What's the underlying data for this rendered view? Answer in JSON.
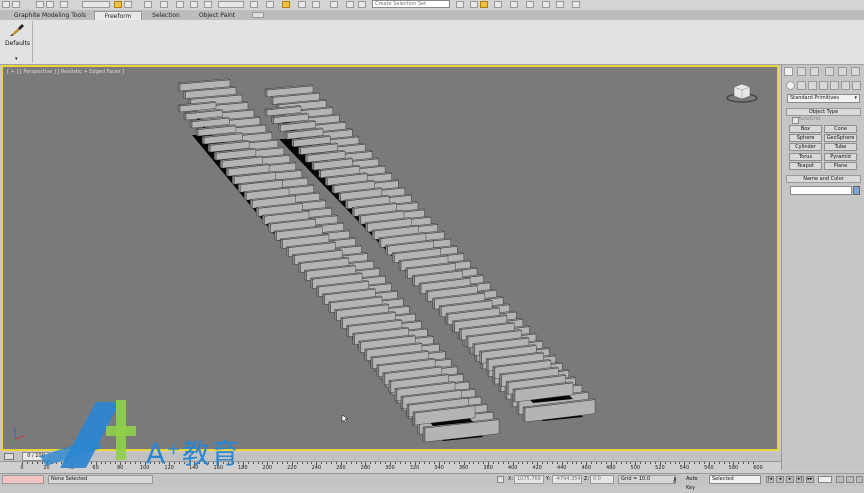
{
  "toolbar": {
    "search_placeholder": "Create Selection Set",
    "icons": [
      "undo-icon",
      "redo-icon",
      "link-icon",
      "unlink-icon",
      "bind-icon",
      "select-filter-icon",
      "select-object-icon",
      "select-by-name-icon",
      "rect-select-icon",
      "window-crossing-icon",
      "move-icon",
      "rotate-icon",
      "scale-icon",
      "ref-coord-icon",
      "pivot-icon",
      "snap-icon",
      "angle-snap-icon",
      "percent-snap-icon",
      "spinner-snap-icon",
      "edit-named-sel-icon",
      "mirror-icon",
      "align-icon",
      "layer-icon",
      "curve-editor-icon",
      "schematic-icon",
      "material-editor-icon",
      "render-setup-icon",
      "render-frame-icon",
      "render-icon"
    ]
  },
  "ribbon": {
    "tabs": [
      "Graphite Modeling Tools",
      "Freeform",
      "Selection",
      "Object Paint"
    ],
    "active_tab": "Freeform",
    "defaults_label": "Defaults"
  },
  "viewport": {
    "label": "[ + ] [ Perspective ] [ Realistic + Edged Faces ]"
  },
  "command_panel": {
    "dropdown": "Standard Primitives",
    "object_type_title": "Object Type",
    "autogrid_label": "AutoGrid",
    "buttons": [
      "Box",
      "Cone",
      "Sphere",
      "GeoSphere",
      "Cylinder",
      "Tube",
      "Torus",
      "Pyramid",
      "Teapot",
      "Plane"
    ],
    "name_color_title": "Name and Color",
    "swatch_color": "#7fa4d8"
  },
  "timeline": {
    "slider": "0 / 100",
    "ticks": [
      "0",
      "20",
      "40",
      "60",
      "80",
      "100",
      "120",
      "140",
      "160",
      "180",
      "200",
      "220",
      "240",
      "260",
      "280",
      "300",
      "320",
      "340",
      "360",
      "380",
      "400",
      "420",
      "440",
      "460",
      "480",
      "500",
      "520",
      "540",
      "560",
      "580",
      "600"
    ]
  },
  "statusbar": {
    "selection": "None Selected",
    "x_label": "X:",
    "x_value": "1075.769",
    "y_label": "Y:",
    "y_value": "-4794.354",
    "z_label": "Z:",
    "z_value": "0.0",
    "grid": "Grid = 10.0",
    "autokey": "Auto Key",
    "selected": "Selected"
  },
  "watermark": {
    "text": "A⁺教育"
  },
  "colors": {
    "viewport_bg": "#7a7a7a",
    "viewport_border": "#e9d43a",
    "watermark": "#2b86d1"
  }
}
